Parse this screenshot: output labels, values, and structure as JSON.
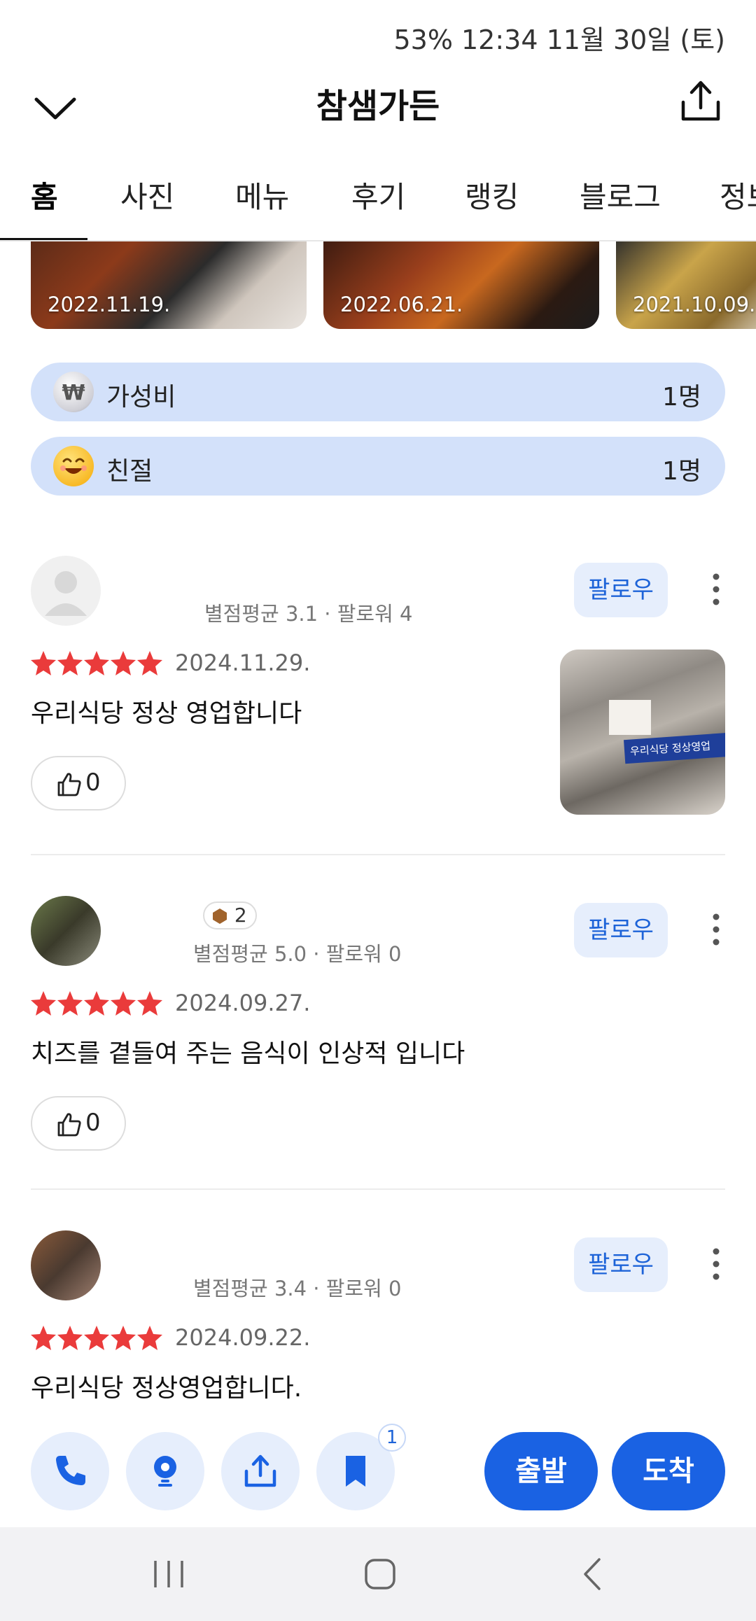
{
  "status_bar": {
    "text": "53%   12:34   11월 30일 (토)"
  },
  "header": {
    "title": "참샘가든",
    "back_icon": "chevron-down-icon",
    "share_icon": "share-icon"
  },
  "tabs": [
    {
      "label": "홈",
      "active": true
    },
    {
      "label": "사진",
      "active": false
    },
    {
      "label": "메뉴",
      "active": false
    },
    {
      "label": "후기",
      "active": false
    },
    {
      "label": "랭킹",
      "active": false
    },
    {
      "label": "블로그",
      "active": false
    },
    {
      "label": "정보",
      "active": false
    }
  ],
  "photos": [
    {
      "date": "2022.11.19."
    },
    {
      "date": "2022.06.21."
    },
    {
      "date": "2021.10.09."
    }
  ],
  "keywords": [
    {
      "icon": "won-coin-icon",
      "label": "가성비",
      "count": "1명"
    },
    {
      "icon": "smile-emoji-icon",
      "label": "친절",
      "count": "1명"
    }
  ],
  "reviews": [
    {
      "meta": "별점평균 3.1 · 팔로워 4",
      "level": "",
      "rating": 5,
      "date": "2024.11.29.",
      "text": "우리식당 정상 영업합니다",
      "likes": "0",
      "follow_label": "팔로우",
      "photo_caption": "우리식당 정상영업"
    },
    {
      "meta": "별점평균 5.0 · 팔로워 0",
      "level": "2",
      "rating": 5,
      "date": "2024.09.27.",
      "text": "치즈를 곁들여  주는 음식이 인상적 입니다",
      "likes": "0",
      "follow_label": "팔로우"
    },
    {
      "meta": "별점평균 3.4 · 팔로워 0",
      "level": "",
      "rating": 5,
      "date": "2024.09.22.",
      "text": "우리식당 정상영업합니다.",
      "follow_label": "팔로우"
    }
  ],
  "bottom_bar": {
    "bookmark_badge": "1",
    "depart_label": "출발",
    "arrive_label": "도착"
  },
  "colors": {
    "accent": "#1a62e3",
    "chip_bg": "#d3e1fa",
    "star": "#ea3b3b"
  }
}
